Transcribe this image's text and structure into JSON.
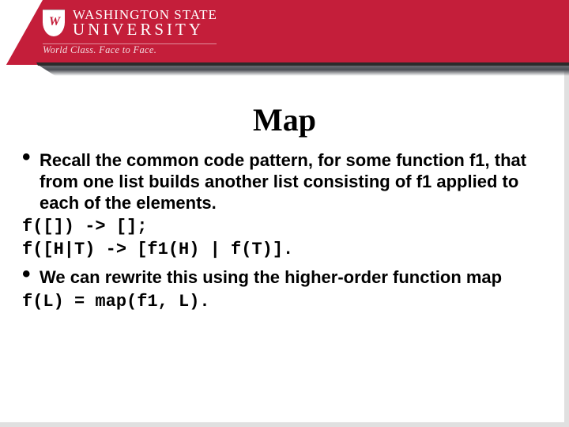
{
  "header": {
    "institution_line1": "WASHINGTON STATE",
    "institution_line2": "UNIVERSITY",
    "tagline": "World Class. Face to Face.",
    "shield_mark": "W"
  },
  "slide": {
    "title": "Map",
    "bullets": [
      "Recall the common code pattern, for some function f1, that from one list builds another list consisting of f1 applied to each of the elements.",
      "We can rewrite this using the higher-order function map"
    ],
    "code_block_1": [
      "f([]) -> [];",
      "f([H|T) -> [f1(H) | f(T)]."
    ],
    "code_block_2": [
      "f(L) = map(f1, L)."
    ]
  }
}
